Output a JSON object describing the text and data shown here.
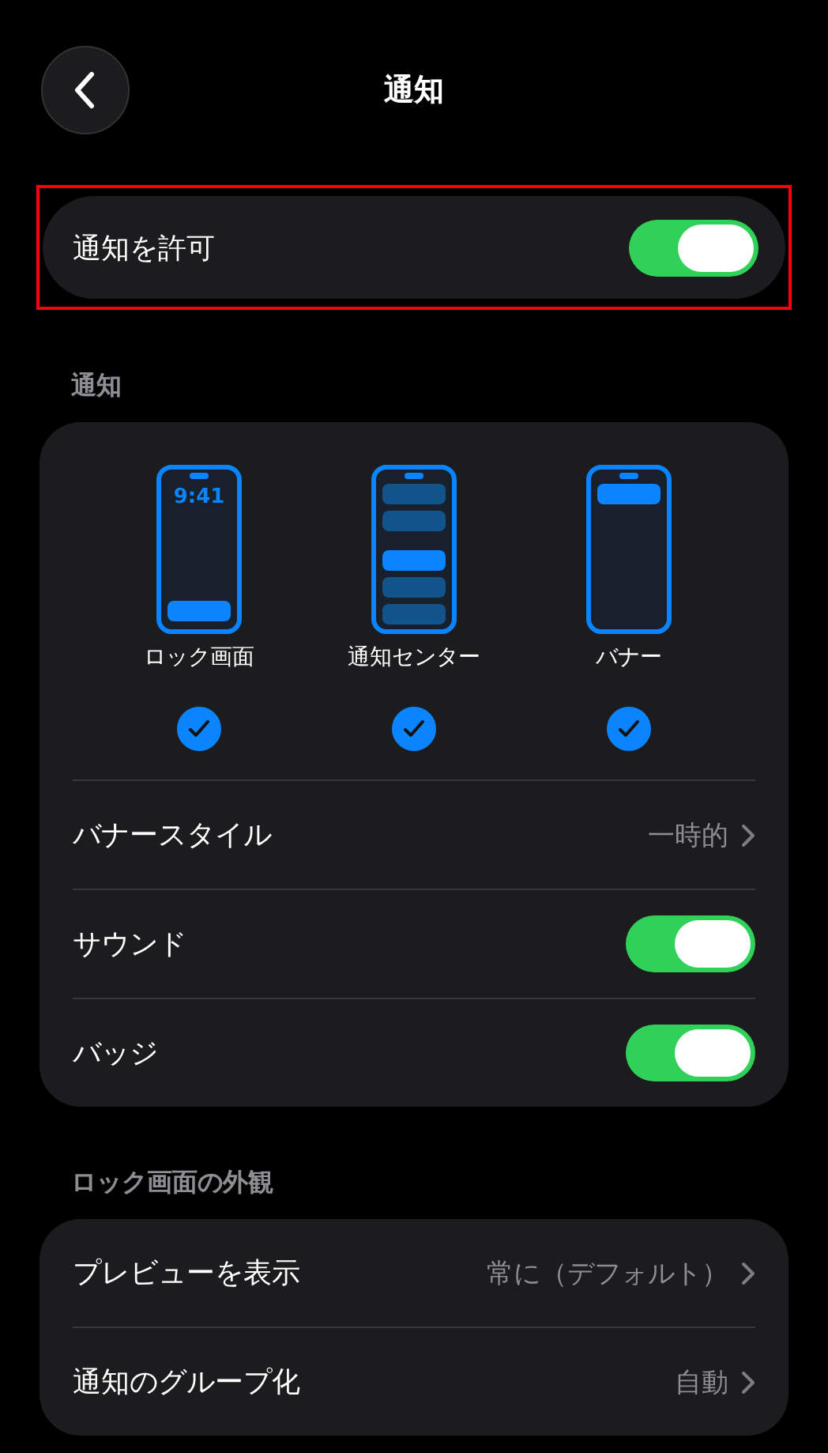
{
  "header": {
    "title": "通知"
  },
  "allow": {
    "label": "通知を許可",
    "on": true,
    "highlighted": true
  },
  "sections": [
    {
      "title": "通知",
      "styles": [
        {
          "kind": "lock",
          "label": "ロック画面",
          "clock": "9:41",
          "checked": true
        },
        {
          "kind": "center",
          "label": "通知センター",
          "checked": true
        },
        {
          "kind": "banner",
          "label": "バナー",
          "checked": true
        }
      ],
      "rows": [
        {
          "kind": "value",
          "label": "バナースタイル",
          "value": "一時的"
        },
        {
          "kind": "toggle",
          "label": "サウンド",
          "on": true
        },
        {
          "kind": "toggle",
          "label": "バッジ",
          "on": true
        }
      ]
    },
    {
      "title": "ロック画面の外観",
      "rows": [
        {
          "kind": "value",
          "label": "プレビューを表示",
          "value": "常に（デフォルト）"
        },
        {
          "kind": "value",
          "label": "通知のグループ化",
          "value": "自動"
        }
      ]
    }
  ]
}
